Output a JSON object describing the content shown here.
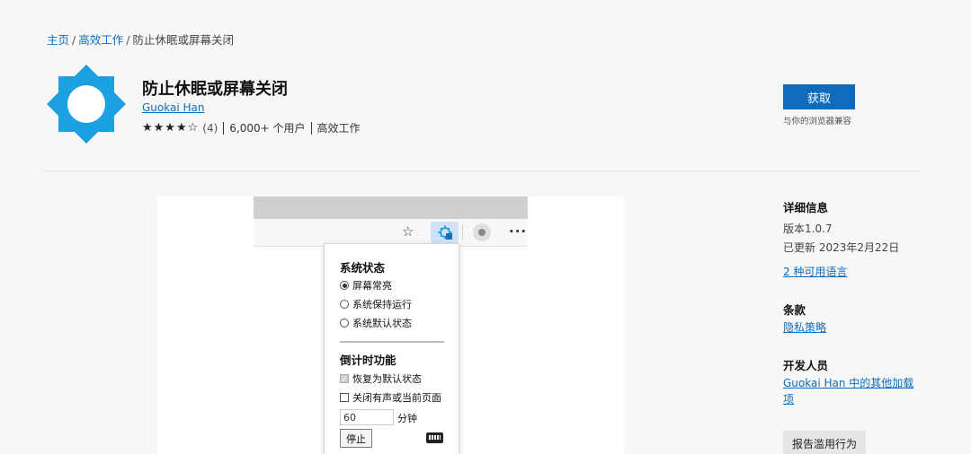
{
  "breadcrumb": {
    "home": "主页",
    "category": "高效工作",
    "current": "防止休眠或屏幕关闭",
    "sep": "/"
  },
  "extension": {
    "icon": "sun-gear-icon",
    "icon_color": "#1ba1e2",
    "title": "防止休眠或屏幕关闭",
    "author": "Guokai Han",
    "stars": "★★★★☆",
    "rating_count": "(4)",
    "users": "6,000+ 个用户",
    "category": "高效工作"
  },
  "get": {
    "label": "获取",
    "compat_note": "与你的浏览器兼容"
  },
  "screenshot": {
    "toolbar_icons": [
      "star-plus-icon",
      "extension-icon",
      "profile-icon",
      "more-icon"
    ],
    "more": "···",
    "popup": {
      "section1_title": "系统状态",
      "options": [
        "屏幕常亮",
        "系统保持运行",
        "系统默认状态"
      ],
      "selected_index": 0,
      "section2_title": "倒计时功能",
      "check_restore": "恢复为默认状态",
      "check_close": "关闭有声或当前页面",
      "minutes_value": "60",
      "minutes_unit": "分钟",
      "stop_label": "停止"
    }
  },
  "details": {
    "heading": "详细信息",
    "version": "版本1.0.7",
    "updated": "已更新 2023年2月22日",
    "languages": "2 种可用语言",
    "terms_heading": "条款",
    "privacy": "隐私策略",
    "developer_heading": "开发人员",
    "developer_link_line1": "Guokai Han 中的其他加载",
    "developer_link_line2": "项",
    "report": "报告滥用行为"
  },
  "colors": {
    "accent": "#0f6cbd",
    "page_bg": "#f7f7f7"
  }
}
